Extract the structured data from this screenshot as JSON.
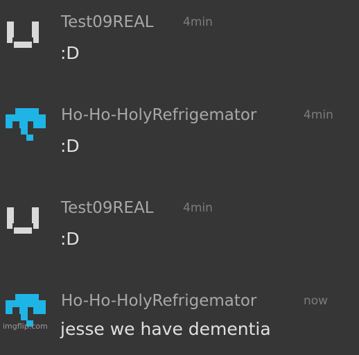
{
  "messages": [
    {
      "author": "Test09REAL",
      "time": "4min",
      "text": ":D",
      "avatar_icon": "smiley-face-icon",
      "avatar_color": "#d9d9d9"
    },
    {
      "author": "Ho-Ho-HolyRefrigemator",
      "time": "4min",
      "text": ":D",
      "avatar_icon": "pixel-invader-icon",
      "avatar_color": "#1fb4e6"
    },
    {
      "author": "Test09REAL",
      "time": "4min",
      "text": ":D",
      "avatar_icon": "smiley-face-icon",
      "avatar_color": "#d9d9d9"
    },
    {
      "author": "Ho-Ho-HolyRefrigemator",
      "time": "now",
      "text": "jesse we have dementia",
      "avatar_icon": "pixel-invader-icon",
      "avatar_color": "#1fb4e6"
    }
  ],
  "watermark": "imgflip.com"
}
